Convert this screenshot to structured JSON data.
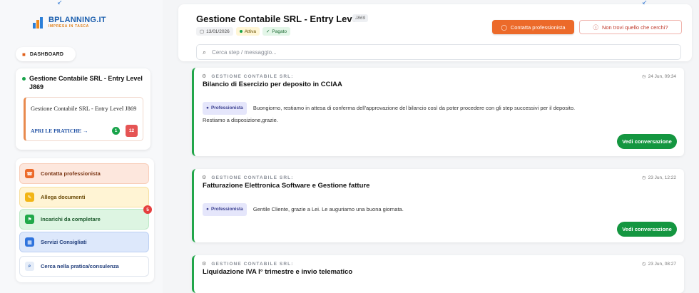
{
  "sidebar": {
    "logo": {
      "title": "BPLANNING.IT",
      "subtitle": "IMPRESA IN TASCA"
    },
    "dashboard_label": "DASHBOARD",
    "practice": {
      "title": "Gestione Contabile SRL - Entry Level J869",
      "inner_title": "Gestione Contabile SRL - Entry Level J869",
      "open_link": "APRI LE PRATICHE →",
      "badge_green": "1",
      "badge_red": "12"
    },
    "menu": [
      {
        "label": "Contatta professionista",
        "icon": "headset-icon"
      },
      {
        "label": "Allega documenti",
        "icon": "paperclip-icon"
      },
      {
        "label": "Incarichi da completare",
        "icon": "flag-icon",
        "badge": "5"
      },
      {
        "label": "Servizi Consigliati",
        "icon": "grid-icon"
      },
      {
        "label": "Cerca nella pratica/consulenza",
        "icon": "search-icon"
      }
    ]
  },
  "header": {
    "title": "Gestione Contabile SRL - Entry Level",
    "code": "J869",
    "date": "13/01/2026",
    "status_active": "Attiva",
    "status_paid": "Pagato",
    "contact_button": "Contatta professionista",
    "help_button": "Non trovi quello che cerchi?",
    "search_placeholder": "Cerca step / messaggio..."
  },
  "messages": [
    {
      "category": "GESTIONE CONTABILE SRL:",
      "time": "24 Jun, 09:34",
      "title": "Bilancio di Esercizio per deposito in CCIAA",
      "sender": "Professionista",
      "line1": "Buongiorno, restiamo in attesa di conferma dell'approvazione del bilancio così da poter procedere con gli step successivi per il deposito.",
      "line2": "Restiamo a disposizione,grazie.",
      "button": "Vedi conversazione"
    },
    {
      "category": "GESTIONE CONTABILE SRL:",
      "time": "23 Jun, 12:22",
      "title": "Fatturazione Elettronica Software e Gestione fatture",
      "sender": "Professionista",
      "line1": "Gentile Cliente, grazie a Lei. Le auguriamo una buona giornata.",
      "button": "Vedi conversazione"
    },
    {
      "category": "GESTIONE CONTABILE SRL:",
      "time": "23 Jun, 08:27",
      "title": "Liquidazione IVA I° trimestre e invio telematico"
    }
  ],
  "colors": {
    "accent_orange": "#ec6a2a",
    "accent_green": "#149640",
    "brand_blue": "#1c5fae"
  }
}
